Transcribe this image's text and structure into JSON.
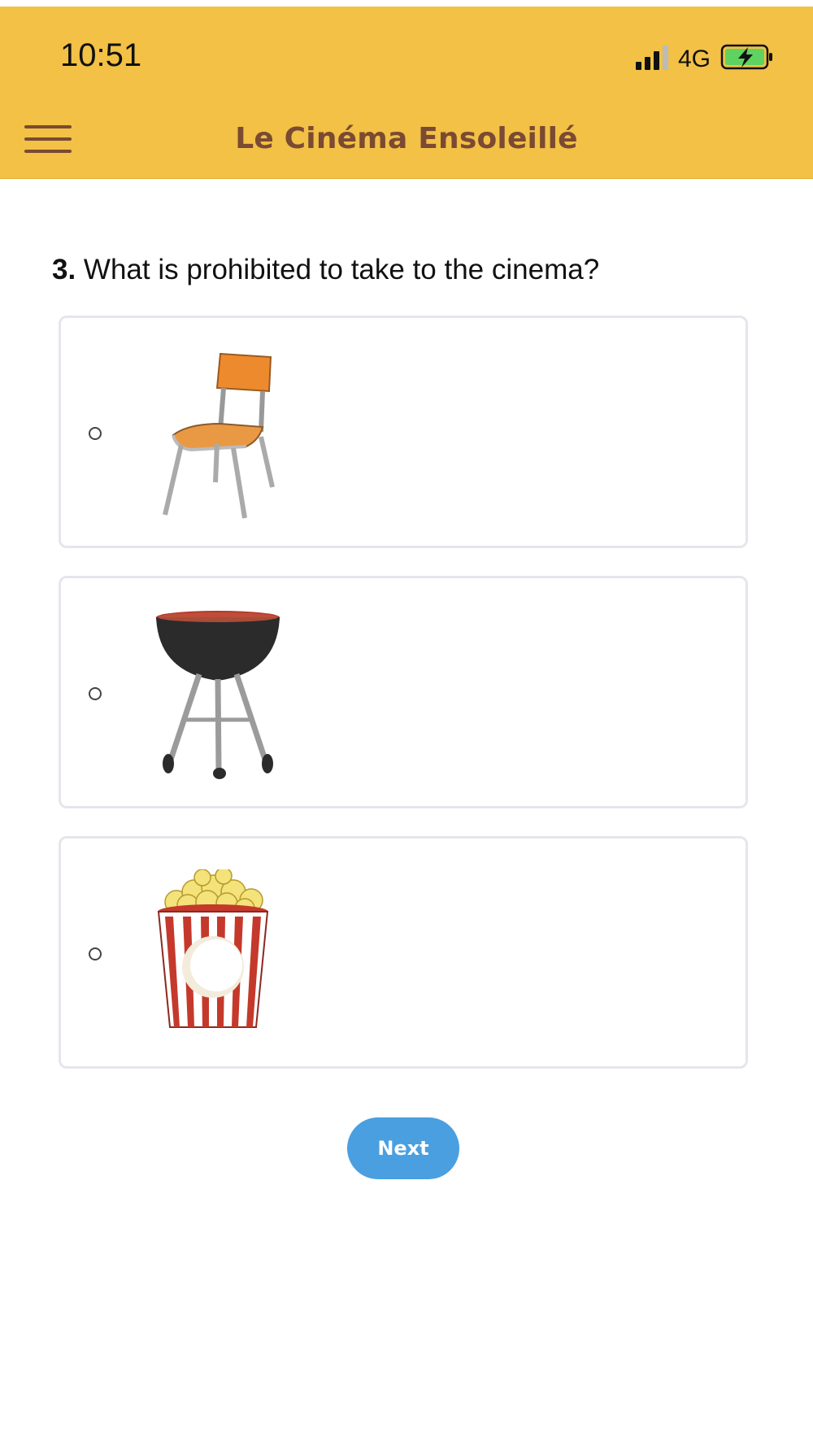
{
  "status_bar": {
    "time": "10:51",
    "network": "4G"
  },
  "header": {
    "title": "Le Cinéma Ensoleillé",
    "background_color": "#f2c146",
    "title_color": "#7a4a32"
  },
  "question": {
    "number": "3.",
    "text": " What is prohibited to take to the cinema?"
  },
  "options": [
    {
      "icon": "chair-image"
    },
    {
      "icon": "barbecue-grill-image"
    },
    {
      "icon": "popcorn-bucket-image"
    }
  ],
  "next_button": {
    "label": "Next",
    "color": "#4a9fe0"
  }
}
